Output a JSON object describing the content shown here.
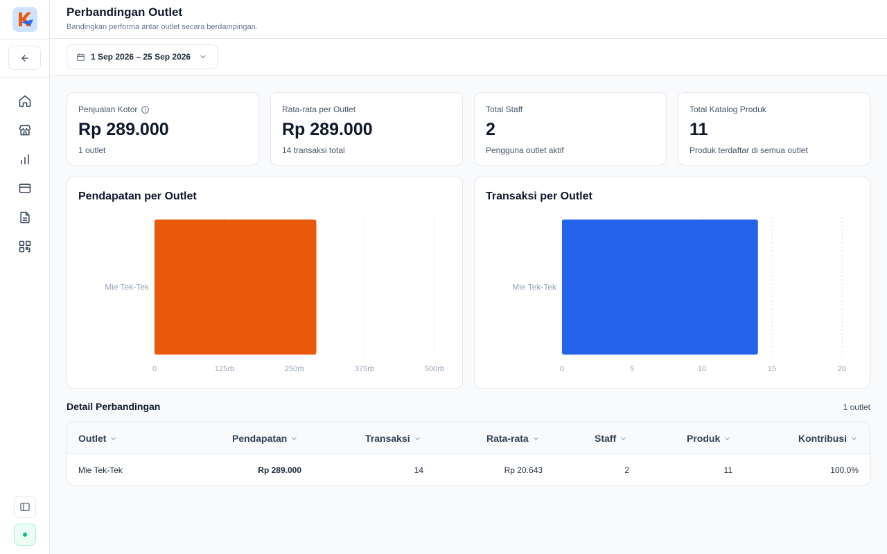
{
  "header": {
    "title": "Perbandingan Outlet",
    "subtitle": "Bandingkan performa antar outlet secara berdampingan."
  },
  "toolbar": {
    "date_range": "1 Sep 2026 – 25 Sep 2026"
  },
  "sidebar": {
    "items": [
      {
        "icon": "home-icon"
      },
      {
        "icon": "store-icon"
      },
      {
        "icon": "bar-chart-icon"
      },
      {
        "icon": "credit-card-icon"
      },
      {
        "icon": "document-icon"
      },
      {
        "icon": "qr-code-icon"
      }
    ]
  },
  "stats": [
    {
      "label": "Penjualan Kotor",
      "value": "Rp 289.000",
      "sub": "1 outlet",
      "has_info": true
    },
    {
      "label": "Rata-rata per Outlet",
      "value": "Rp 289.000",
      "sub": "14 transaksi total",
      "has_info": false
    },
    {
      "label": "Total Staff",
      "value": "2",
      "sub": "Pengguna outlet aktif",
      "has_info": false
    },
    {
      "label": "Total Katalog Produk",
      "value": "11",
      "sub": "Produk terdaftar di semua outlet",
      "has_info": false
    }
  ],
  "chart_data": [
    {
      "type": "bar",
      "orientation": "horizontal",
      "title": "Pendapatan per Outlet",
      "categories": [
        "Mie Tek-Tek"
      ],
      "values": [
        289000
      ],
      "xlim": [
        0,
        500000
      ],
      "ticks": [
        0,
        125000,
        250000,
        375000,
        500000
      ],
      "tick_labels": [
        "0",
        "125rb",
        "250rb",
        "375rb",
        "500rb"
      ],
      "color": "#ea580c",
      "grid": true
    },
    {
      "type": "bar",
      "orientation": "horizontal",
      "title": "Transaksi per Outlet",
      "categories": [
        "Mie Tek-Tek"
      ],
      "values": [
        14
      ],
      "xlim": [
        0,
        20
      ],
      "ticks": [
        0,
        5,
        10,
        15,
        20
      ],
      "tick_labels": [
        "0",
        "5",
        "10",
        "15",
        "20"
      ],
      "color": "#2563eb",
      "grid": true
    }
  ],
  "table": {
    "title": "Detail Perbandingan",
    "count": "1 outlet",
    "columns": [
      "Outlet",
      "Pendapatan",
      "Transaksi",
      "Rata-rata",
      "Staff",
      "Produk",
      "Kontribusi"
    ],
    "rows": [
      [
        "Mie Tek-Tek",
        "Rp 289.000",
        "14",
        "Rp 20.643",
        "2",
        "11",
        "100.0%"
      ]
    ]
  },
  "colors": {
    "accent_orange": "#ea580c",
    "accent_blue": "#2563eb",
    "status_green": "#10b981"
  }
}
